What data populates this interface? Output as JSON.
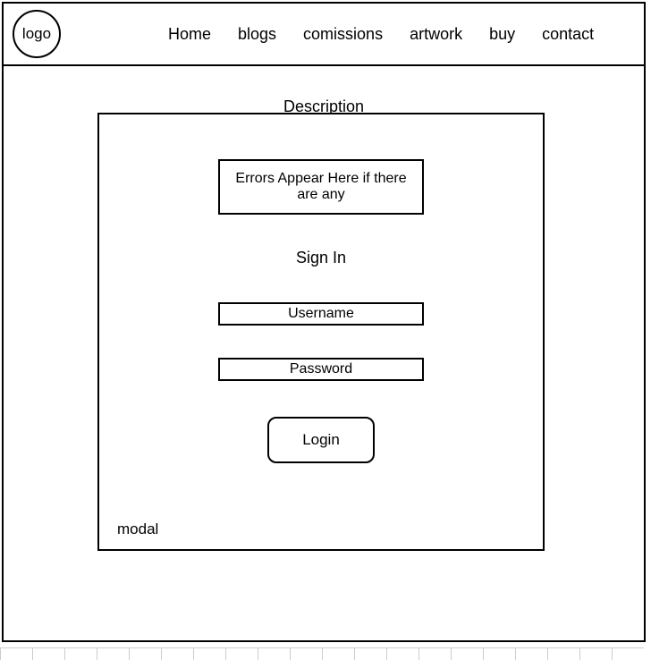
{
  "header": {
    "logo_text": "logo",
    "nav": [
      {
        "label": "Home"
      },
      {
        "label": "blogs"
      },
      {
        "label": "comissions"
      },
      {
        "label": "artwork"
      },
      {
        "label": "buy"
      },
      {
        "label": "contact"
      }
    ]
  },
  "main": {
    "description_label": "Description",
    "modal": {
      "error_text": "Errors Appear Here if there are any",
      "signin_label": "Sign In",
      "username_placeholder": "Username",
      "password_placeholder": "Password",
      "login_button_label": "Login",
      "modal_label": "modal"
    }
  }
}
